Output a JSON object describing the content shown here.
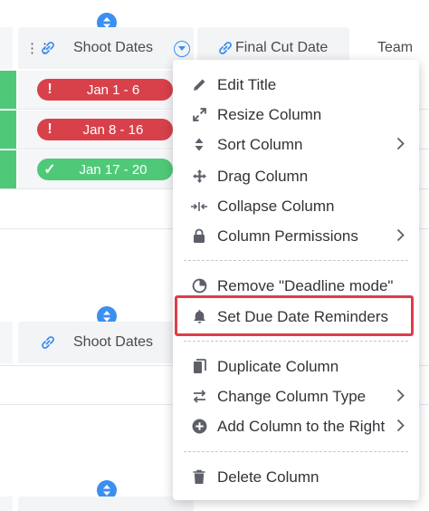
{
  "board": {
    "columns": {
      "shoot_dates": "Shoot Dates",
      "final_cut_date": "Final Cut Date",
      "team": "Team"
    },
    "rows": [
      {
        "date_range": "Jan 1 - 6",
        "status": "overdue",
        "status_icon": "!"
      },
      {
        "date_range": "Jan 8 - 16",
        "status": "overdue",
        "status_icon": "!"
      },
      {
        "date_range": "Jan 17 - 20",
        "status": "done",
        "status_icon": "✓"
      }
    ],
    "second_group": {
      "shoot_dates": "Shoot Dates"
    },
    "colors": {
      "overdue": "#d8414a",
      "done": "#4fc978",
      "accent": "#3b8ff0",
      "highlight": "#dc3d4b"
    }
  },
  "column_menu": {
    "items": [
      {
        "label": "Edit Title",
        "icon": "pencil-icon"
      },
      {
        "label": "Resize Column",
        "icon": "resize-icon"
      },
      {
        "label": "Sort Column",
        "icon": "sort-icon",
        "has_submenu": true
      },
      {
        "label": "Drag Column",
        "icon": "move-icon"
      },
      {
        "label": "Collapse Column",
        "icon": "collapse-icon"
      },
      {
        "label": "Column Permissions",
        "icon": "lock-icon",
        "has_submenu": true
      },
      {
        "label": "Remove \"Deadline mode\"",
        "icon": "deadline-icon"
      },
      {
        "label": "Set Due Date Reminders",
        "icon": "bell-icon",
        "highlighted": true
      },
      {
        "label": "Duplicate Column",
        "icon": "duplicate-icon"
      },
      {
        "label": "Change Column Type",
        "icon": "swap-icon",
        "has_submenu": true
      },
      {
        "label": "Add Column to the Right",
        "icon": "plus-circle-icon",
        "has_submenu": true
      },
      {
        "label": "Delete Column",
        "icon": "trash-icon"
      }
    ]
  }
}
